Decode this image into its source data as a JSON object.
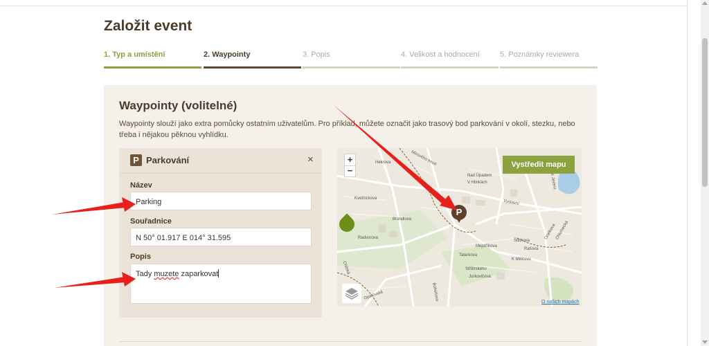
{
  "page": {
    "title": "Založit event"
  },
  "steps": [
    {
      "label": "1. Typ a umístění",
      "state": "done"
    },
    {
      "label": "2. Waypointy",
      "state": "active"
    },
    {
      "label": "3. Popis",
      "state": "todo"
    },
    {
      "label": "4. Velikost a hodnocení",
      "state": "todo"
    },
    {
      "label": "5. Poznámky reviewera",
      "state": "todo"
    }
  ],
  "section": {
    "heading": "Waypointy (volitelné)",
    "description": "Waypointy slouží jako extra pomůcky ostatním uživatelům. Pro příklad, můžete označit jako trasový bod parkování v okolí, stezku, nebo třeba i nějakou pěknou vyhlídku."
  },
  "waypoint": {
    "badge": "P",
    "title": "Parkování",
    "close_glyph": "×",
    "name_label": "Název",
    "name_value": "Parking",
    "coords_label": "Souřadnice",
    "coords_value": "N 50° 01.917 E 014° 31.595",
    "desc_label": "Popis",
    "desc_word1": "Tady",
    "desc_word2": "muzete",
    "desc_word3": "zaparkovat"
  },
  "map": {
    "zoom_in": "+",
    "zoom_out": "−",
    "center_button": "Vystředit mapu",
    "attribution_link": "O našich mapách",
    "pin_label": "P",
    "streets": [
      "Hekrova",
      "Mírového hnutí",
      "Nad Úpadem",
      "V Hlinkách",
      "Vystavní",
      "K Jezeru",
      "Kvetnickova",
      "Brandlova",
      "Radvorova",
      "Tatarkova",
      "Mejstříkova",
      "Štichova",
      "Rašova",
      "K Milíčovu",
      "Stříbrského",
      "Jurkovičova",
      "Opatovská",
      "Bohúňova",
      "Chilská",
      "Ocelkova",
      "Chlumecká"
    ]
  },
  "colors": {
    "accent_green": "#8ba23f",
    "brown": "#5e3f2c",
    "panel_bg": "#f5f0e9",
    "arrow_red": "#e8201c"
  }
}
